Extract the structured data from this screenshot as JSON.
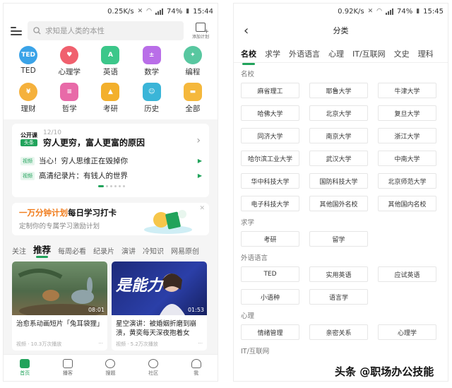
{
  "left": {
    "status": {
      "speed": "0.25K/s",
      "battery": "74%",
      "time": "15:44"
    },
    "search": {
      "placeholder": "求知是人类的本性"
    },
    "add_plan_label": "添加计划",
    "categories": [
      "TED",
      "心理学",
      "英语",
      "数学",
      "编程",
      "理财",
      "哲学",
      "考研",
      "历史",
      "全部"
    ],
    "gongkaike": {
      "logo_top": "公开课",
      "logo_bottom": "头条",
      "date": "12/10",
      "headline": "穷人更穷，富人更富的原因",
      "items": [
        {
          "tag": "视频",
          "text": "当心！穷人思维正在毁掉你"
        },
        {
          "tag": "视频",
          "text": "高清纪录片：有钱人的世界"
        }
      ]
    },
    "promo": {
      "title_accent": "一万分钟计划",
      "title_rest": "每日学习打卡",
      "subtitle": "定制你的专属学习激励计划"
    },
    "tabs": [
      "关注",
      "推荐",
      "每周必看",
      "纪录片",
      "演讲",
      "冷知识",
      "网易原创"
    ],
    "videos": [
      {
        "title": "治愈系动画短片「兔耳袋狸」",
        "meta": "视频 · 10.3万次播放",
        "duration": "08:01"
      },
      {
        "title": "星空演讲：被婚姻折磨到崩溃，黄奕每天深夜抱着女儿...",
        "meta": "视频 · 5.2万次播放",
        "duration": "01:53",
        "thumb_text": "是能力"
      }
    ],
    "nav": [
      "首页",
      "播客",
      "搜题",
      "社区",
      "我"
    ]
  },
  "right": {
    "status": {
      "speed": "0.92K/s",
      "battery": "74%",
      "time": "15:45"
    },
    "title": "分类",
    "tabs": [
      "名校",
      "求学",
      "外语语言",
      "心理",
      "IT/互联网",
      "文史",
      "理科"
    ],
    "sections": {
      "mingxiao": {
        "title": "名校",
        "items": [
          "麻省理工",
          "耶鲁大学",
          "牛津大学",
          "哈佛大学",
          "北京大学",
          "复旦大学",
          "同济大学",
          "南京大学",
          "浙江大学",
          "哈尔滨工业大学",
          "武汉大学",
          "中南大学",
          "华中科技大学",
          "国防科技大学",
          "北京师范大学",
          "电子科技大学",
          "其他国外名校",
          "其他国内名校"
        ]
      },
      "qiuxue": {
        "title": "求学",
        "items": [
          "考研",
          "留学"
        ]
      },
      "waiyu": {
        "title": "外语语言",
        "items": [
          "TED",
          "实用英语",
          "应试英语",
          "小语种",
          "语言学"
        ]
      },
      "xinli": {
        "title": "心理",
        "items": [
          "情绪管理",
          "亲密关系",
          "心理学"
        ]
      },
      "it": {
        "title": "IT/互联网"
      }
    }
  },
  "watermark": "头条 @职场办公技能",
  "colors": {
    "accent": "#21a35b",
    "promo_accent": "#f07c1c"
  }
}
